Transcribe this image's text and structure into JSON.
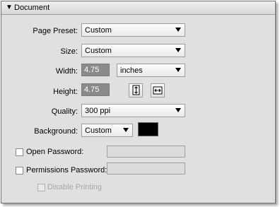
{
  "panel": {
    "title": "Document",
    "collapse_icon": "triangle-down-icon"
  },
  "page_preset": {
    "label": "Page Preset:",
    "value": "Custom"
  },
  "size": {
    "label": "Size:",
    "value": "Custom"
  },
  "width": {
    "label": "Width:",
    "value": "4.75",
    "unit": "inches"
  },
  "height": {
    "label": "Height:",
    "value": "4.75",
    "icons": [
      "portrait-orientation-icon",
      "landscape-orientation-icon"
    ]
  },
  "quality": {
    "label": "Quality:",
    "value": "300 ppi"
  },
  "background": {
    "label": "Background:",
    "value": "Custom",
    "color": "#000000"
  },
  "open_password": {
    "label": "Open Password:",
    "checked": false,
    "value": ""
  },
  "permissions_password": {
    "label": "Permissions Password:",
    "checked": false,
    "value": ""
  },
  "disable_printing": {
    "label": "Disable Printing",
    "checked": false,
    "disabled": true
  }
}
